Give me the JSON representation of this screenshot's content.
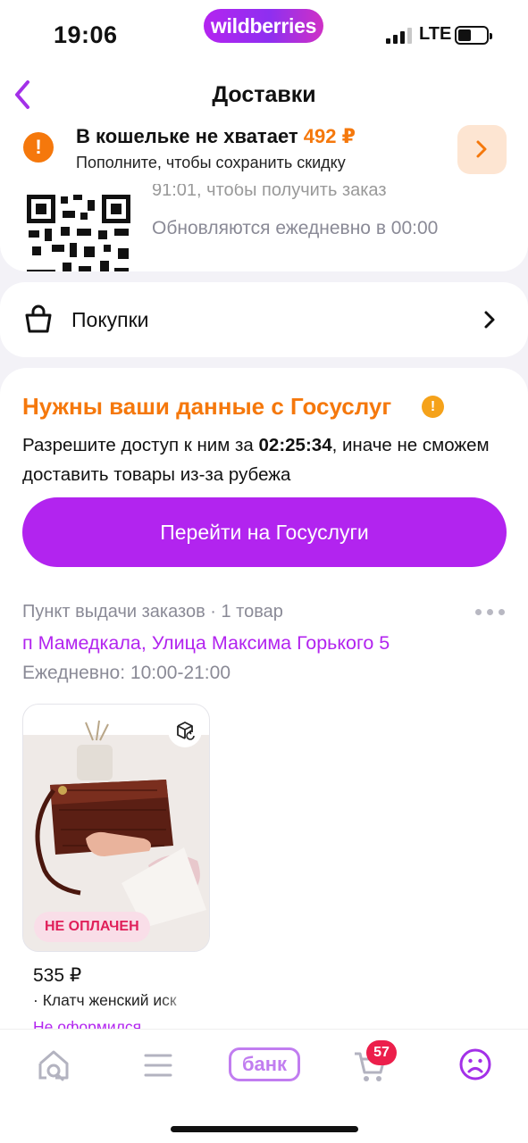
{
  "status_bar": {
    "time": "19:06",
    "network": "LTE",
    "brand": "wildberries"
  },
  "header": {
    "title": "Доставки"
  },
  "wallet_banner": {
    "title": "В кошельке не хватает",
    "amount": "492 ₽",
    "subtitle": "Пополните, чтобы сохранить скидку"
  },
  "qr_card": {
    "partial_text": "91:01, чтобы получить заказ",
    "updated_text": "Обновляются ежедневно в 00:00"
  },
  "purchases": {
    "label": "Покупки"
  },
  "gosuslugi": {
    "title": "Нужны ваши данные с Госуслуг",
    "text_before": "Разрешите доступ к ним за ",
    "timer": "02:25:34",
    "text_after": ", иначе не сможем доставить товары из-за рубежа",
    "button_label": "Перейти на Госуслуги"
  },
  "pickup": {
    "type": "Пункт выдачи заказов · 1 товар",
    "address": "п Мамедкала, Улица Максима Горького 5",
    "hours": "Ежедневно: 10:00-21:00"
  },
  "product": {
    "badge": "НЕ ОПЛАЧЕН",
    "price": "535 ₽",
    "name": "· Клатч женский иск",
    "status": "Не оформился"
  },
  "bottom_nav": {
    "items": [
      {
        "icon": "home-search-icon"
      },
      {
        "icon": "menu-icon"
      },
      {
        "label": "банк"
      },
      {
        "icon": "cart-icon",
        "badge": "57"
      },
      {
        "icon": "profile-icon"
      }
    ]
  },
  "colors": {
    "accent": "#b224ef",
    "orange": "#f5780c",
    "badge_red": "#ec1f4b"
  }
}
